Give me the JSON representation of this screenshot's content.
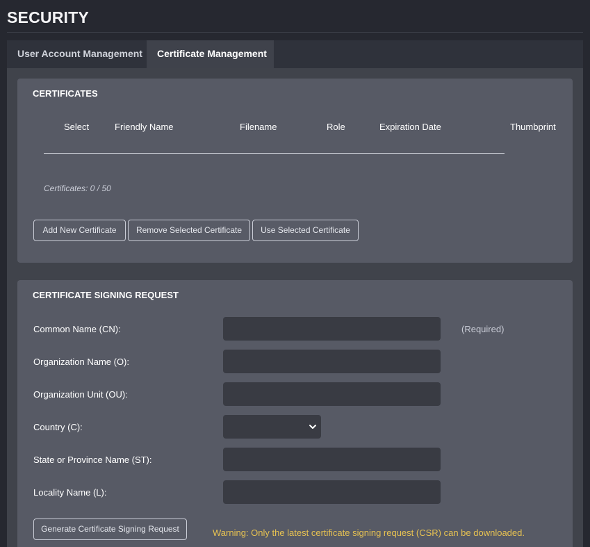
{
  "page": {
    "title": "SECURITY"
  },
  "tabs": [
    {
      "label": "User Account Management",
      "active": false
    },
    {
      "label": "Certificate Management",
      "active": true
    }
  ],
  "certificates": {
    "title": "CERTIFICATES",
    "columns": [
      "Select",
      "Friendly Name",
      "Filename",
      "Role",
      "Expiration Date",
      "Thumbprint"
    ],
    "rows": [],
    "count_text": "Certificates: 0 / 50",
    "buttons": {
      "add": "Add New Certificate",
      "remove": "Remove Selected Certificate",
      "use": "Use Selected Certificate"
    }
  },
  "csr": {
    "title": "CERTIFICATE SIGNING REQUEST",
    "fields": {
      "common_name": {
        "label": "Common Name (CN):",
        "value": ""
      },
      "organization_name": {
        "label": "Organization Name (O):",
        "value": ""
      },
      "organization_unit": {
        "label": "Organization Unit (OU):",
        "value": ""
      },
      "country": {
        "label": "Country (C):",
        "selected": ""
      },
      "state": {
        "label": "State or Province Name (ST):",
        "value": ""
      },
      "locality": {
        "label": "Locality Name (L):",
        "value": ""
      }
    },
    "required_note": "(Required)",
    "generate_button": "Generate Certificate Signing Request",
    "warning": "Warning: Only the latest certificate signing request (CSR) can be downloaded."
  },
  "icons": {
    "country_dropdown": "chevron-down-icon"
  },
  "colors": {
    "background": "#262830",
    "card": "#575a65",
    "input": "#393b43",
    "warning": "#e7c252"
  }
}
